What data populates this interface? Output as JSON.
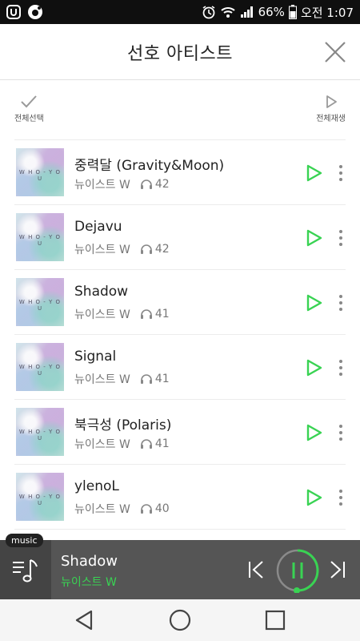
{
  "status_bar": {
    "battery": "66%",
    "time": "오전 1:07"
  },
  "header": {
    "title": "선호 아티스트"
  },
  "actions": {
    "select_all": "전체선택",
    "play_all": "전체재생"
  },
  "songs": [
    {
      "title": "중력달 (Gravity&Moon)",
      "artist": "뉴이스트 W",
      "plays": "42"
    },
    {
      "title": "Dejavu",
      "artist": "뉴이스트 W",
      "plays": "42"
    },
    {
      "title": "Shadow",
      "artist": "뉴이스트 W",
      "plays": "41"
    },
    {
      "title": "Signal",
      "artist": "뉴이스트 W",
      "plays": "41"
    },
    {
      "title": "북극성 (Polaris)",
      "artist": "뉴이스트 W",
      "plays": "41"
    },
    {
      "title": "ylenoL",
      "artist": "뉴이스트 W",
      "plays": "40"
    }
  ],
  "album_art_text": "W H O - Y O U",
  "player": {
    "tab_label": "music",
    "title": "Shadow",
    "artist": "뉴이스트 W"
  },
  "colors": {
    "accent": "#39d353",
    "player_bg": "#555555"
  }
}
